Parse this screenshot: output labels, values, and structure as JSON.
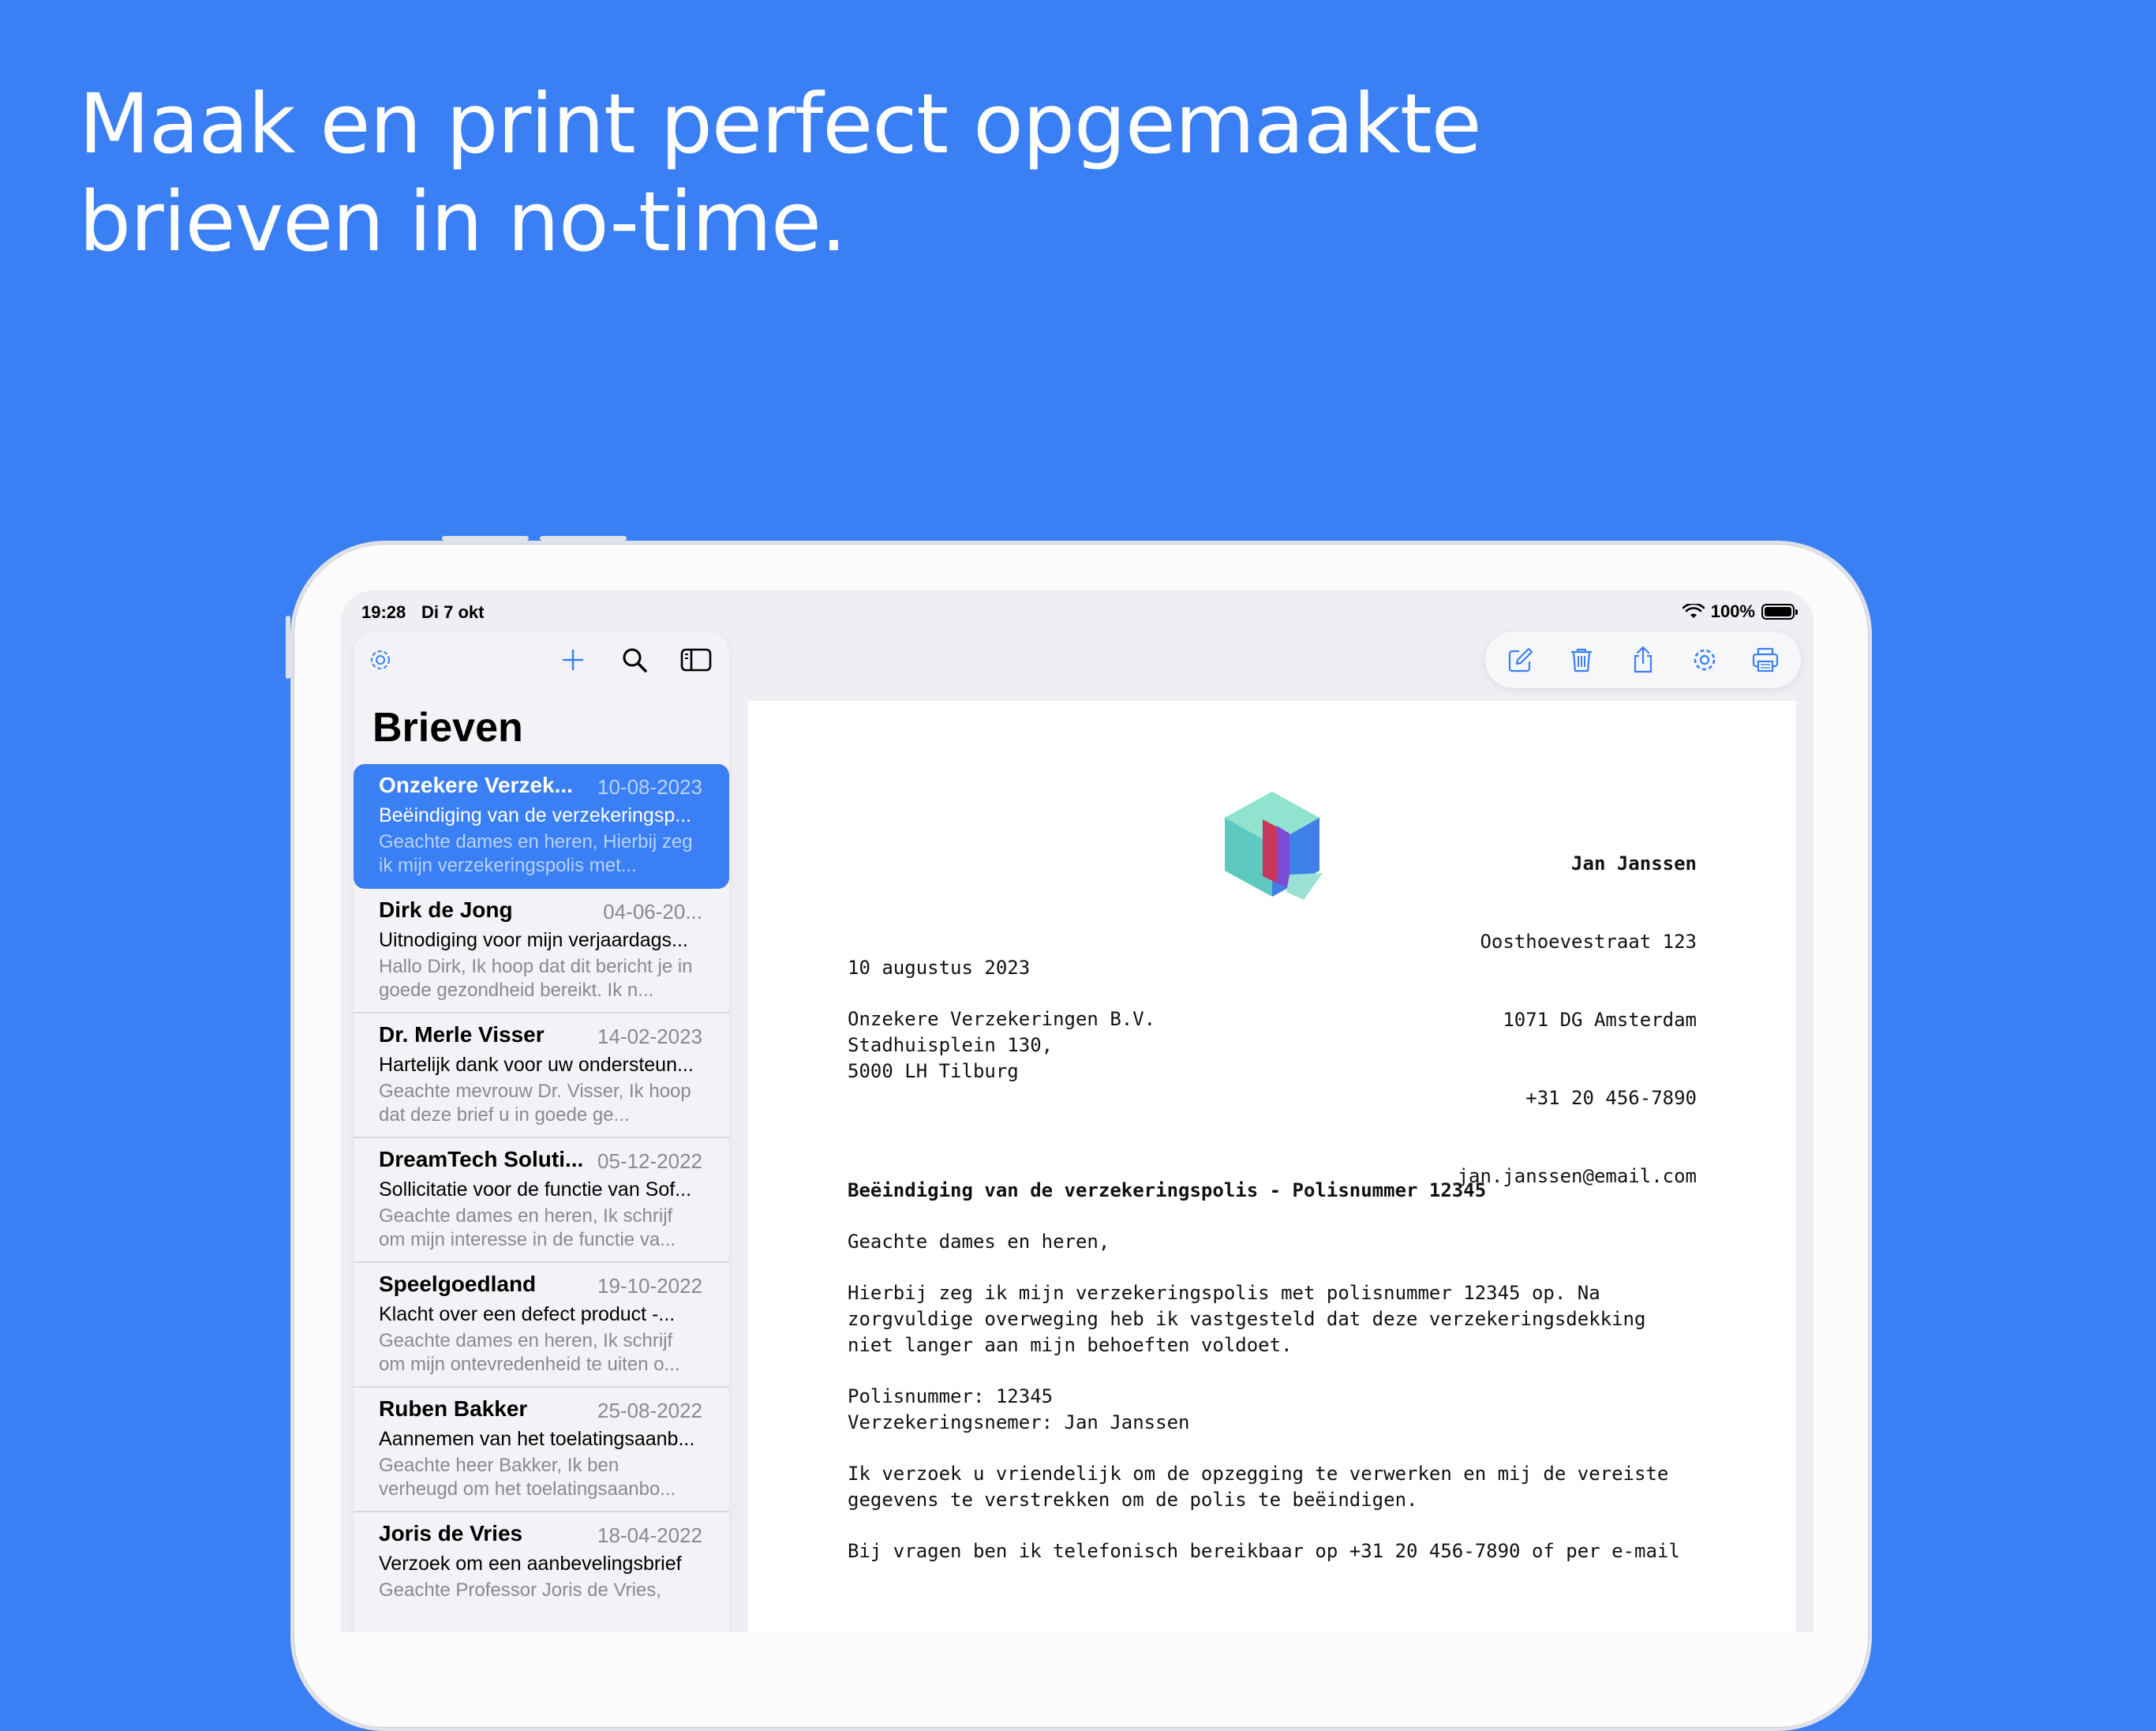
{
  "headline": {
    "line1": "Maak en print perfect opgemaakte",
    "line2": "brieven in no-time."
  },
  "status_bar": {
    "time": "19:28",
    "date": "Di 7 okt",
    "battery": "100%"
  },
  "sidebar": {
    "title": "Brieven",
    "letters": [
      {
        "name": "Onzekere Verzek...",
        "date": "10-08-2023",
        "subject": "Beëindiging van de verzekeringsp...",
        "preview": "Geachte dames en heren,  Hierbij zeg ik mijn verzekeringspolis met...",
        "selected": true
      },
      {
        "name": "Dirk de Jong",
        "date": "04-06-20...",
        "subject": "Uitnodiging voor mijn verjaardags...",
        "preview": "Hallo Dirk,  Ik hoop dat dit bericht je in goede gezondheid bereikt. Ik n..."
      },
      {
        "name": "Dr. Merle Visser",
        "date": "14-02-2023",
        "subject": "Hartelijk dank voor uw ondersteun...",
        "preview": "Geachte mevrouw Dr. Visser,  Ik hoop dat deze brief u in goede ge..."
      },
      {
        "name": "DreamTech Soluti...",
        "date": "05-12-2022",
        "subject": "Sollicitatie voor de functie van Sof...",
        "preview": "Geachte dames en heren,  Ik schrijf om mijn interesse in de functie va..."
      },
      {
        "name": "Speelgoedland",
        "date": "19-10-2022",
        "subject": "Klacht over een defect product -...",
        "preview": "Geachte dames en heren,  Ik schrijf om mijn ontevredenheid te uiten o..."
      },
      {
        "name": "Ruben Bakker",
        "date": "25-08-2022",
        "subject": "Aannemen van het toelatingsaanb...",
        "preview": "Geachte heer Bakker,  Ik ben verheugd om het toelatingsaanbo..."
      },
      {
        "name": "Joris de Vries",
        "date": "18-04-2022",
        "subject": "Verzoek om een aanbevelingsbrief",
        "preview": "Geachte Professor Joris de Vries,"
      }
    ]
  },
  "toolbar": {
    "icons": [
      "settings-icon",
      "plus-icon",
      "search-icon",
      "sidebar-toggle-icon",
      "compose-icon",
      "trash-icon",
      "share-icon",
      "gear-icon",
      "print-icon"
    ]
  },
  "letter": {
    "sender": {
      "name": "Jan Janssen",
      "street": "Oosthoevestraat 123",
      "city": "1071 DG Amsterdam",
      "phone": "+31 20 456-7890",
      "email": "jan.janssen@email.com"
    },
    "date": "10 augustus 2023",
    "recipient": {
      "company": "Onzekere Verzekeringen B.V.",
      "street": "Stadhuisplein 130,",
      "city": "5000 LH Tilburg"
    },
    "subject": "Beëindiging van de verzekeringspolis - Polisnummer 12345",
    "salutation": "Geachte dames en heren,",
    "paragraph1": "Hierbij zeg ik mijn verzekeringspolis met polisnummer 12345 op. Na zorgvuldige overweging heb ik vastgesteld dat deze verzekeringsdekking niet langer aan mijn behoeften voldoet.",
    "policy_line": "Polisnummer: 12345",
    "holder_line": "Verzekeringsnemer: Jan Janssen",
    "paragraph2": "Ik verzoek u vriendelijk om de opzegging te verwerken en mij de vereiste gegevens te verstrekken om de polis te beëindigen.",
    "paragraph3": "Bij vragen ben ik telefonisch bereikbaar op +31 20 456-7890 of per e-mail"
  },
  "colors": {
    "background": "#3a80f4",
    "accent": "#3a80f4",
    "selected_row": "#3a80f4"
  }
}
